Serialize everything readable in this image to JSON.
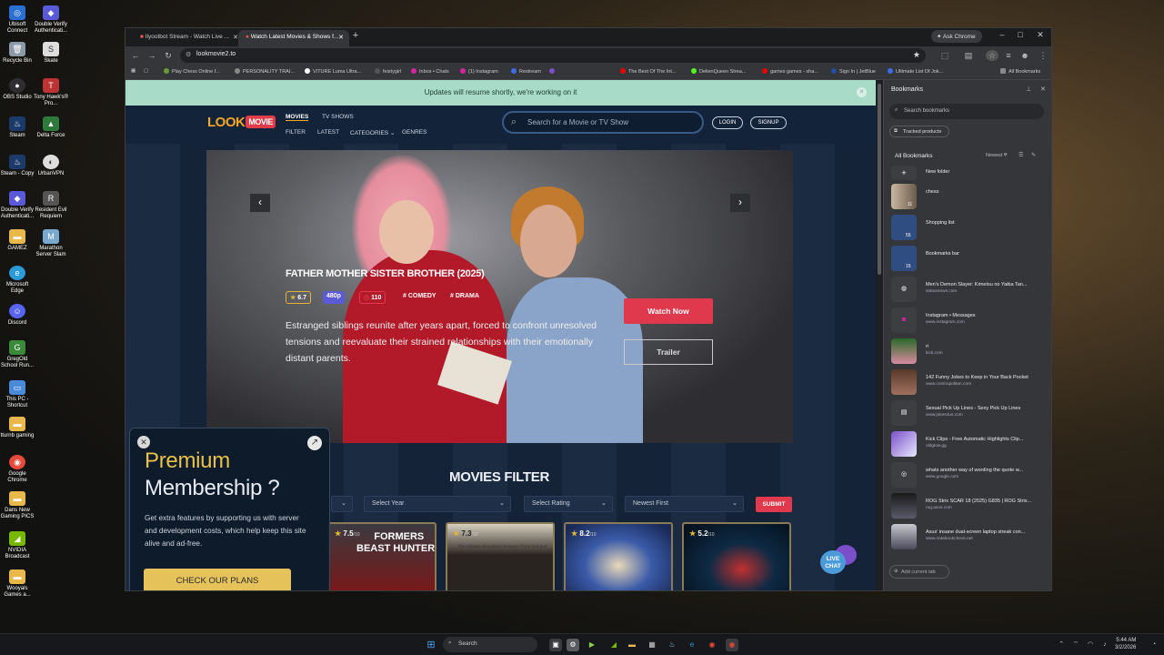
{
  "desktop": {
    "icons": [
      {
        "label": "Ubisoft Connect",
        "icon": "ubisoft-icon"
      },
      {
        "label": "Double Verify Authenticati...",
        "icon": "shield-icon"
      },
      {
        "label": "Recycle Bin",
        "icon": "trash-icon"
      },
      {
        "label": "Skate",
        "icon": "game-icon"
      },
      {
        "label": "OBS Studio",
        "icon": "obs-icon"
      },
      {
        "label": "Tony Hawk's® Pro...",
        "icon": "game-icon"
      },
      {
        "label": "Steam",
        "icon": "steam-icon"
      },
      {
        "label": "Delta Force",
        "icon": "game-icon"
      },
      {
        "label": "Steam - Copy",
        "icon": "steam-icon"
      },
      {
        "label": "UrbanVPN",
        "icon": "vpn-icon"
      },
      {
        "label": "Double Verify Authenticati...",
        "icon": "shield-icon"
      },
      {
        "label": "Resident Evil Requiem",
        "icon": "game-icon"
      },
      {
        "label": "GAMEZ",
        "icon": "folder-icon"
      },
      {
        "label": "Marathon Server Slam",
        "icon": "game-icon"
      },
      {
        "label": "Microsoft Edge",
        "icon": "edge-icon"
      },
      {
        "label": "Discord",
        "icon": "discord-icon"
      },
      {
        "label": "GregOld School Run...",
        "icon": "game-icon"
      },
      {
        "label": "This PC - Shortcut",
        "icon": "pc-icon"
      },
      {
        "label": "tturnb gaming",
        "icon": "folder-icon"
      },
      {
        "label": "Google Chrome",
        "icon": "chrome-icon"
      },
      {
        "label": "Dans New Gaming PICS",
        "icon": "folder-icon"
      },
      {
        "label": "NVIDIA Broadcast",
        "icon": "nvidia-icon"
      },
      {
        "label": "Wooyals Games a...",
        "icon": "folder-icon"
      }
    ]
  },
  "browser": {
    "tabs": [
      {
        "label": "Ilyootbot Stream - Watch Live ..."
      },
      {
        "label": "Watch Latest Movies & Shows f..."
      }
    ],
    "ask_chrome": "Ask Chrome",
    "url": "lookmovie2.to",
    "bookmarks_bar": [
      {
        "label": "Play Chess Online f...",
        "color": "#6a9a3a"
      },
      {
        "label": "PERSONALITY TRAI...",
        "color": "#888"
      },
      {
        "label": "VITURE Luma Ultra...",
        "color": "#fff"
      },
      {
        "label": "feistygirl",
        "color": "#333"
      },
      {
        "label": "Inbox • Chats",
        "color": "#d6249f"
      },
      {
        "label": "(1) Instagram",
        "color": "#d6249f"
      },
      {
        "label": "Restream",
        "color": "#3c6cf0"
      },
      {
        "label": "",
        "color": "#7a4fc9"
      },
      {
        "label": "The Best Of The Int...",
        "color": "#e00"
      },
      {
        "label": "DelienQueen Strea...",
        "color": "#53fc18"
      },
      {
        "label": "games games - sha...",
        "color": "#e00"
      },
      {
        "label": "Sign In | JetBlue",
        "color": "#1e4fa0"
      },
      {
        "label": "Ultimate List Of Jok...",
        "color": "#3c6cf0"
      },
      {
        "label": "All Bookmarks",
        "color": "#888"
      }
    ]
  },
  "site": {
    "banner": "Updates will resume shortly, we're working on it",
    "logo_look": "LOOK",
    "logo_movie": "MOVIE",
    "nav": {
      "movies": "MOVIES",
      "tv": "TV SHOWS",
      "filter": "FILTER",
      "latest": "LATEST",
      "categories": "CATEGORIES",
      "genres": "GENRES"
    },
    "search_placeholder": "Search for a Movie or TV Show",
    "login": "LOGIN",
    "signup": "SIGNUP",
    "hero": {
      "title": "FATHER MOTHER SISTER BROTHER (2025)",
      "rating": "6.7",
      "quality": "480p",
      "duration": "110",
      "genre1": "# COMEDY",
      "genre2": "# DRAMA",
      "description": "Estranged siblings reunite after years apart, forced to confront unresolved tensions and reevaluate their strained relationships with their emotionally distant parents.",
      "watch_now": "Watch Now",
      "trailer": "Trailer"
    },
    "filter": {
      "title": "MOVIES FILTER",
      "year": "Select Year",
      "rating": "Select Rating",
      "sort": "Newest First",
      "submit": "SUBMIT"
    },
    "posters": [
      {
        "rating": "7.5",
        "text": "FORMERS\nBEAST HUNTERS",
        "bg": "#5a1010"
      },
      {
        "rating": "7.3",
        "text": "The Ultimate Showdown Between Good And Evil",
        "bg": "#2a2420"
      },
      {
        "rating": "8.2",
        "text": "",
        "bg": "#2a3d78"
      },
      {
        "rating": "5.2",
        "text": "",
        "bg": "#0e2a44"
      }
    ],
    "premium": {
      "line1": "Premium",
      "line2": "Membership ?",
      "body": "Get extra features by supporting us with server and development costs, which help keep this site alive and ad-free.",
      "cta": "CHECK OUR PLANS"
    },
    "live_chat": "LIVE CHAT"
  },
  "bookmarks_panel": {
    "title": "Bookmarks",
    "search_placeholder": "Search bookmarks",
    "tracked": "Tracked products",
    "all": "All Bookmarks",
    "sort": "Newest",
    "items": [
      {
        "title": "New folder",
        "sub": "",
        "badge": "+"
      },
      {
        "title": "chess",
        "sub": "",
        "badge": "11"
      },
      {
        "title": "Shopping list",
        "sub": "",
        "badge": "55"
      },
      {
        "title": "Bookmarks bar",
        "sub": "",
        "badge": "15"
      },
      {
        "title": "Men's Demon Slayer: Kimetsu no Yaiba Tan...",
        "sub": "statusnews.com",
        "badge": ""
      },
      {
        "title": "Instagram • Messages",
        "sub": "www.instagram.com",
        "badge": ""
      },
      {
        "title": "ri",
        "sub": "kick.com",
        "badge": ""
      },
      {
        "title": "142 Funny Jokes to Keep in Your Back Pocket",
        "sub": "www.cosmopolitan.com",
        "badge": ""
      },
      {
        "title": "Sexual Pick Up Lines - Sexy Pick Up Lines",
        "sub": "www.jokes4us.com",
        "badge": ""
      },
      {
        "title": "Kick Clips - Free Automatic Highlights Clip...",
        "sub": "oldglow.gg",
        "badge": ""
      },
      {
        "title": "whats another way of wording the quote w...",
        "sub": "www.google.com",
        "badge": ""
      },
      {
        "title": "ROG Strix SCAR 18 (2025) G835 | ROG Strix...",
        "sub": "rog.asus.com",
        "badge": ""
      },
      {
        "title": "Asus' insane dual-screen laptop streak con...",
        "sub": "www.notebookcheck.net",
        "badge": ""
      }
    ],
    "add_current": "Add current tab"
  },
  "taskbar": {
    "search": "Search",
    "time": "5:44 AM",
    "date": "3/2/2026"
  }
}
